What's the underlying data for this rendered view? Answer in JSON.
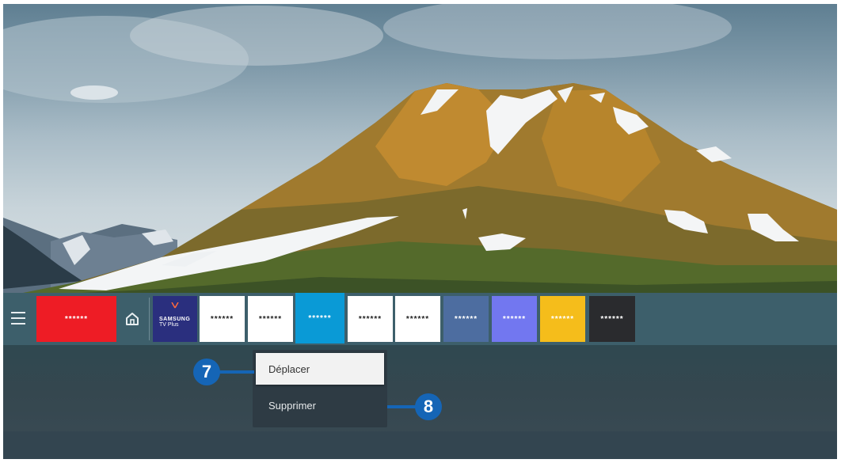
{
  "app_bar": {
    "tiles": [
      {
        "label": "******",
        "color": "#ee1c25"
      },
      {
        "label": "******",
        "color": "#ffffff"
      },
      {
        "label": "******",
        "color": "#ffffff"
      },
      {
        "label": "******",
        "color": "#0a9ad6",
        "focused": true
      },
      {
        "label": "******",
        "color": "#ffffff"
      },
      {
        "label": "******",
        "color": "#ffffff"
      },
      {
        "label": "******",
        "color": "#4d6da0"
      },
      {
        "label": "******",
        "color": "#7277f0"
      },
      {
        "label": "******",
        "color": "#f5bd1b"
      },
      {
        "label": "******",
        "color": "#2a2b2e"
      }
    ],
    "samsung_tile": {
      "brand": "SAMSUNG",
      "sub": "TV Plus"
    },
    "icons": {
      "menu": "hamburger-menu-icon",
      "home": "home-icon"
    }
  },
  "context_menu": {
    "items": [
      {
        "label": "Déplacer",
        "focused": true
      },
      {
        "label": "Supprimer",
        "focused": false
      }
    ]
  },
  "callouts": {
    "seven": "7",
    "eight": "8"
  },
  "colors": {
    "callout": "#1565b6",
    "appbar": "#3d5f6b"
  }
}
